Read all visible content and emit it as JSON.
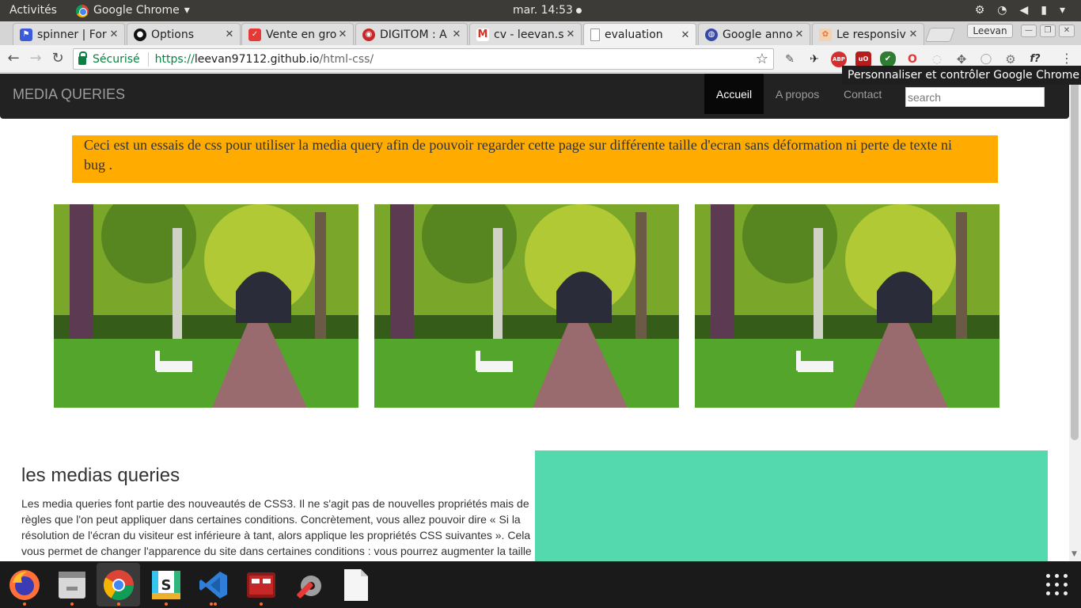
{
  "topbar": {
    "activities": "Activités",
    "app_name": "Google Chrome",
    "app_menu_arrow": "▾",
    "clock": "mar. 14:53"
  },
  "tabs": [
    {
      "label": "spinner | For",
      "favicon": "flag-icon",
      "color": "#3b5bdb"
    },
    {
      "label": "Options",
      "favicon": "github-icon",
      "color": "#111111"
    },
    {
      "label": "Vente en gro",
      "favicon": "pocket-icon",
      "color": "#e53935"
    },
    {
      "label": "DIGITOM : A",
      "favicon": "digitom-icon",
      "color": "#c62828"
    },
    {
      "label": "cv - leevan.s",
      "favicon": "gmail-icon",
      "color": "#d93025"
    },
    {
      "label": "evaluation",
      "favicon": "document-icon",
      "color": "#9e9e9e"
    },
    {
      "label": "Google anno",
      "favicon": "google-ads-icon",
      "color": "#3949ab"
    },
    {
      "label": "Le responsiv",
      "favicon": "palette-icon",
      "color": "#e07b39"
    }
  ],
  "tab_close": "✕",
  "profile": "Leevan",
  "omnibox": {
    "secure_label": "Sécurisé",
    "url_scheme": "https://",
    "url_host": "leevan97112.github.io",
    "url_path": "/html-css/"
  },
  "extensions": [
    {
      "name": "eyedropper-icon",
      "text": "✎",
      "color": "#555555"
    },
    {
      "name": "bird-icon",
      "text": "✈",
      "color": "#222222"
    },
    {
      "name": "adblock-plus-icon",
      "text": "ABP",
      "color": "#d32f2f"
    },
    {
      "name": "ublock-icon",
      "text": "uO",
      "color": "#b71c1c"
    },
    {
      "name": "shield-check-icon",
      "text": "✔",
      "color": "#2e7d32"
    },
    {
      "name": "opera-icon",
      "text": "O",
      "color": "#e53935"
    },
    {
      "name": "grey-circle-icon",
      "text": "◌",
      "color": "#bdbdbd"
    },
    {
      "name": "move-arrows-icon",
      "text": "✥",
      "color": "#666666"
    },
    {
      "name": "code-circle-icon",
      "text": "◯",
      "color": "#9e9e9e"
    },
    {
      "name": "settings-gear-icon",
      "text": "⚙",
      "color": "#777777"
    },
    {
      "name": "fonts-icon",
      "text": "f?",
      "color": "#333333"
    }
  ],
  "tooltip": "Personnaliser et contrôler Google Chrome",
  "site": {
    "brand": "MEDIA QUERIES",
    "nav": [
      "Accueil",
      "A propos",
      "Contact"
    ],
    "search_placeholder": "search",
    "intro": "Ceci est un essais de css pour utiliser la media query afin de pouvoir regarder cette page sur différente taille d'ecran sans déformation ni perte de texte ni bug .",
    "section_title": "les medias queries",
    "section_text": "Les media queries font partie des nouveautés de CSS3. Il ne s'agit pas de nouvelles propriétés mais de règles que l'on peut appliquer dans certaines conditions. Concrètement, vous allez pouvoir dire « Si la résolution de l'écran du visiteur est inférieure à tant, alors applique les propriétés CSS suivantes ». Cela vous permet de changer l'apparence du site dans certaines conditions : vous pourrez augmenter la taille",
    "colors": {
      "navbar": "#222222",
      "intro_bg": "#ffab00",
      "green_block": "#54d8ae"
    }
  },
  "dock": [
    {
      "name": "firefox-icon",
      "running": true
    },
    {
      "name": "files-icon",
      "running": true
    },
    {
      "name": "chrome-icon",
      "running": true
    },
    {
      "name": "slack-icon",
      "running": true
    },
    {
      "name": "vscode-icon",
      "running": true
    },
    {
      "name": "terminal-icon",
      "running": true
    },
    {
      "name": "settings-tools-icon",
      "running": false
    },
    {
      "name": "text-file-icon",
      "running": false
    }
  ]
}
